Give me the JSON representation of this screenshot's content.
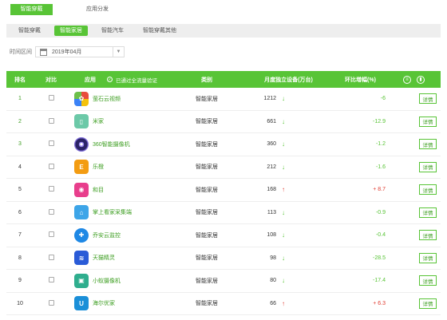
{
  "top_tabs": [
    "智能穿戴",
    "应用分发"
  ],
  "subnav": [
    "智能穿戴",
    "智能家居",
    "智能汽车",
    "智能穿戴其他"
  ],
  "time": {
    "label": "时间区间",
    "value": "2019年04月"
  },
  "table": {
    "headers": {
      "rank": "排名",
      "compare": "对比",
      "app": "应用",
      "verified": "已通过全流量验证",
      "category": "类别",
      "users": "月度独立设备(万台)",
      "change": "环比增幅(%)"
    },
    "detail_label": "详情",
    "rows": [
      {
        "rank": "1",
        "name": "萤石云视频",
        "category": "智能家居",
        "users": "1212",
        "trend": "down",
        "change": "-6"
      },
      {
        "rank": "2",
        "name": "米家",
        "category": "智能家居",
        "users": "661",
        "trend": "down",
        "change": "-12.9"
      },
      {
        "rank": "3",
        "name": "360智能摄像机",
        "category": "智能家居",
        "users": "360",
        "trend": "down",
        "change": "-1.2"
      },
      {
        "rank": "4",
        "name": "乐橙",
        "category": "智能家居",
        "users": "212",
        "trend": "down",
        "change": "-1.6"
      },
      {
        "rank": "5",
        "name": "和目",
        "category": "智能家居",
        "users": "168",
        "trend": "up",
        "change": "+ 8.7"
      },
      {
        "rank": "6",
        "name": "掌上看家采集端",
        "category": "智能家居",
        "users": "113",
        "trend": "down",
        "change": "-0.9"
      },
      {
        "rank": "7",
        "name": "乔安云监控",
        "category": "智能家居",
        "users": "108",
        "trend": "down",
        "change": "-0.4"
      },
      {
        "rank": "8",
        "name": "天猫精灵",
        "category": "智能家居",
        "users": "98",
        "trend": "down",
        "change": "-28.5"
      },
      {
        "rank": "9",
        "name": "小蚁摄像机",
        "category": "智能家居",
        "users": "80",
        "trend": "down",
        "change": "-17.4"
      },
      {
        "rank": "10",
        "name": "海尔优家",
        "category": "智能家居",
        "users": "66",
        "trend": "up",
        "change": "+ 6.3"
      }
    ]
  },
  "colors": {
    "accent": "#58c436",
    "down": "#58c436",
    "up": "#e03c31"
  },
  "icons": {
    "app_icons": [
      "pinwheel-icon",
      "mi-home-icon",
      "camera-lens-icon",
      "lechange-icon",
      "heimu-camera-icon",
      "home-camera-icon",
      "qiaoan-icon",
      "tmall-genie-icon",
      "xiaoyi-camera-icon",
      "haier-u-icon"
    ],
    "head_icons": [
      "list-icon",
      "bar-chart-icon"
    ]
  }
}
